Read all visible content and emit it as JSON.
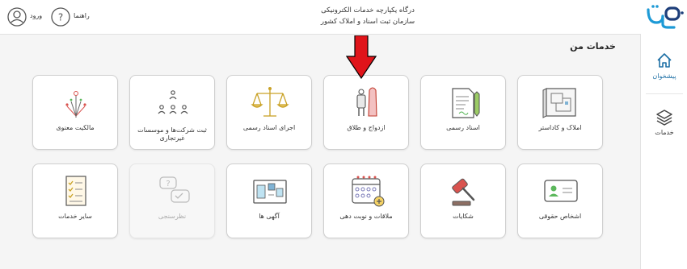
{
  "header": {
    "title_line1": "درگاه یکپارچه خدمات الکترونیکی",
    "title_line2": "سازمان ثبت اسناد و املاک کشور",
    "login_label": "ورود",
    "help_label": "راهنما"
  },
  "logo": {
    "text": "ثبت من"
  },
  "sidebar": {
    "items": [
      {
        "label": "پیشخوان",
        "icon": "home-icon",
        "active": true
      },
      {
        "label": "خدمات",
        "icon": "layers-icon",
        "active": false
      }
    ]
  },
  "main": {
    "section_title": "خدمات من",
    "cards": [
      {
        "label": "مالکیت معنوی",
        "icon": "ideas-icon"
      },
      {
        "label": "ثبت شرکت‌ها و موسسات غیرتجاری",
        "icon": "org-chart-icon"
      },
      {
        "label": "اجرای اسناد رسمی",
        "icon": "scales-icon"
      },
      {
        "label": "ازدواج و طلاق",
        "icon": "couple-icon"
      },
      {
        "label": "اسناد رسمی",
        "icon": "document-pen-icon"
      },
      {
        "label": "املاک و کاداستر",
        "icon": "blueprint-icon"
      },
      {
        "label": "سایر خدمات",
        "icon": "checklist-icon"
      },
      {
        "label": "نظرسنجی",
        "icon": "survey-chat-icon",
        "disabled": true
      },
      {
        "label": "آگهی ها",
        "icon": "notice-board-icon"
      },
      {
        "label": "ملاقات و نوبت دهی",
        "icon": "calendar-add-icon"
      },
      {
        "label": "شکایات",
        "icon": "gavel-icon"
      },
      {
        "label": "اشخاص حقوقی",
        "icon": "id-card-icon"
      }
    ]
  },
  "colors": {
    "accent": "#1d6fa5",
    "arrow": "#e0141a",
    "icon_red": "#d9534f",
    "icon_green": "#5cb85c"
  }
}
